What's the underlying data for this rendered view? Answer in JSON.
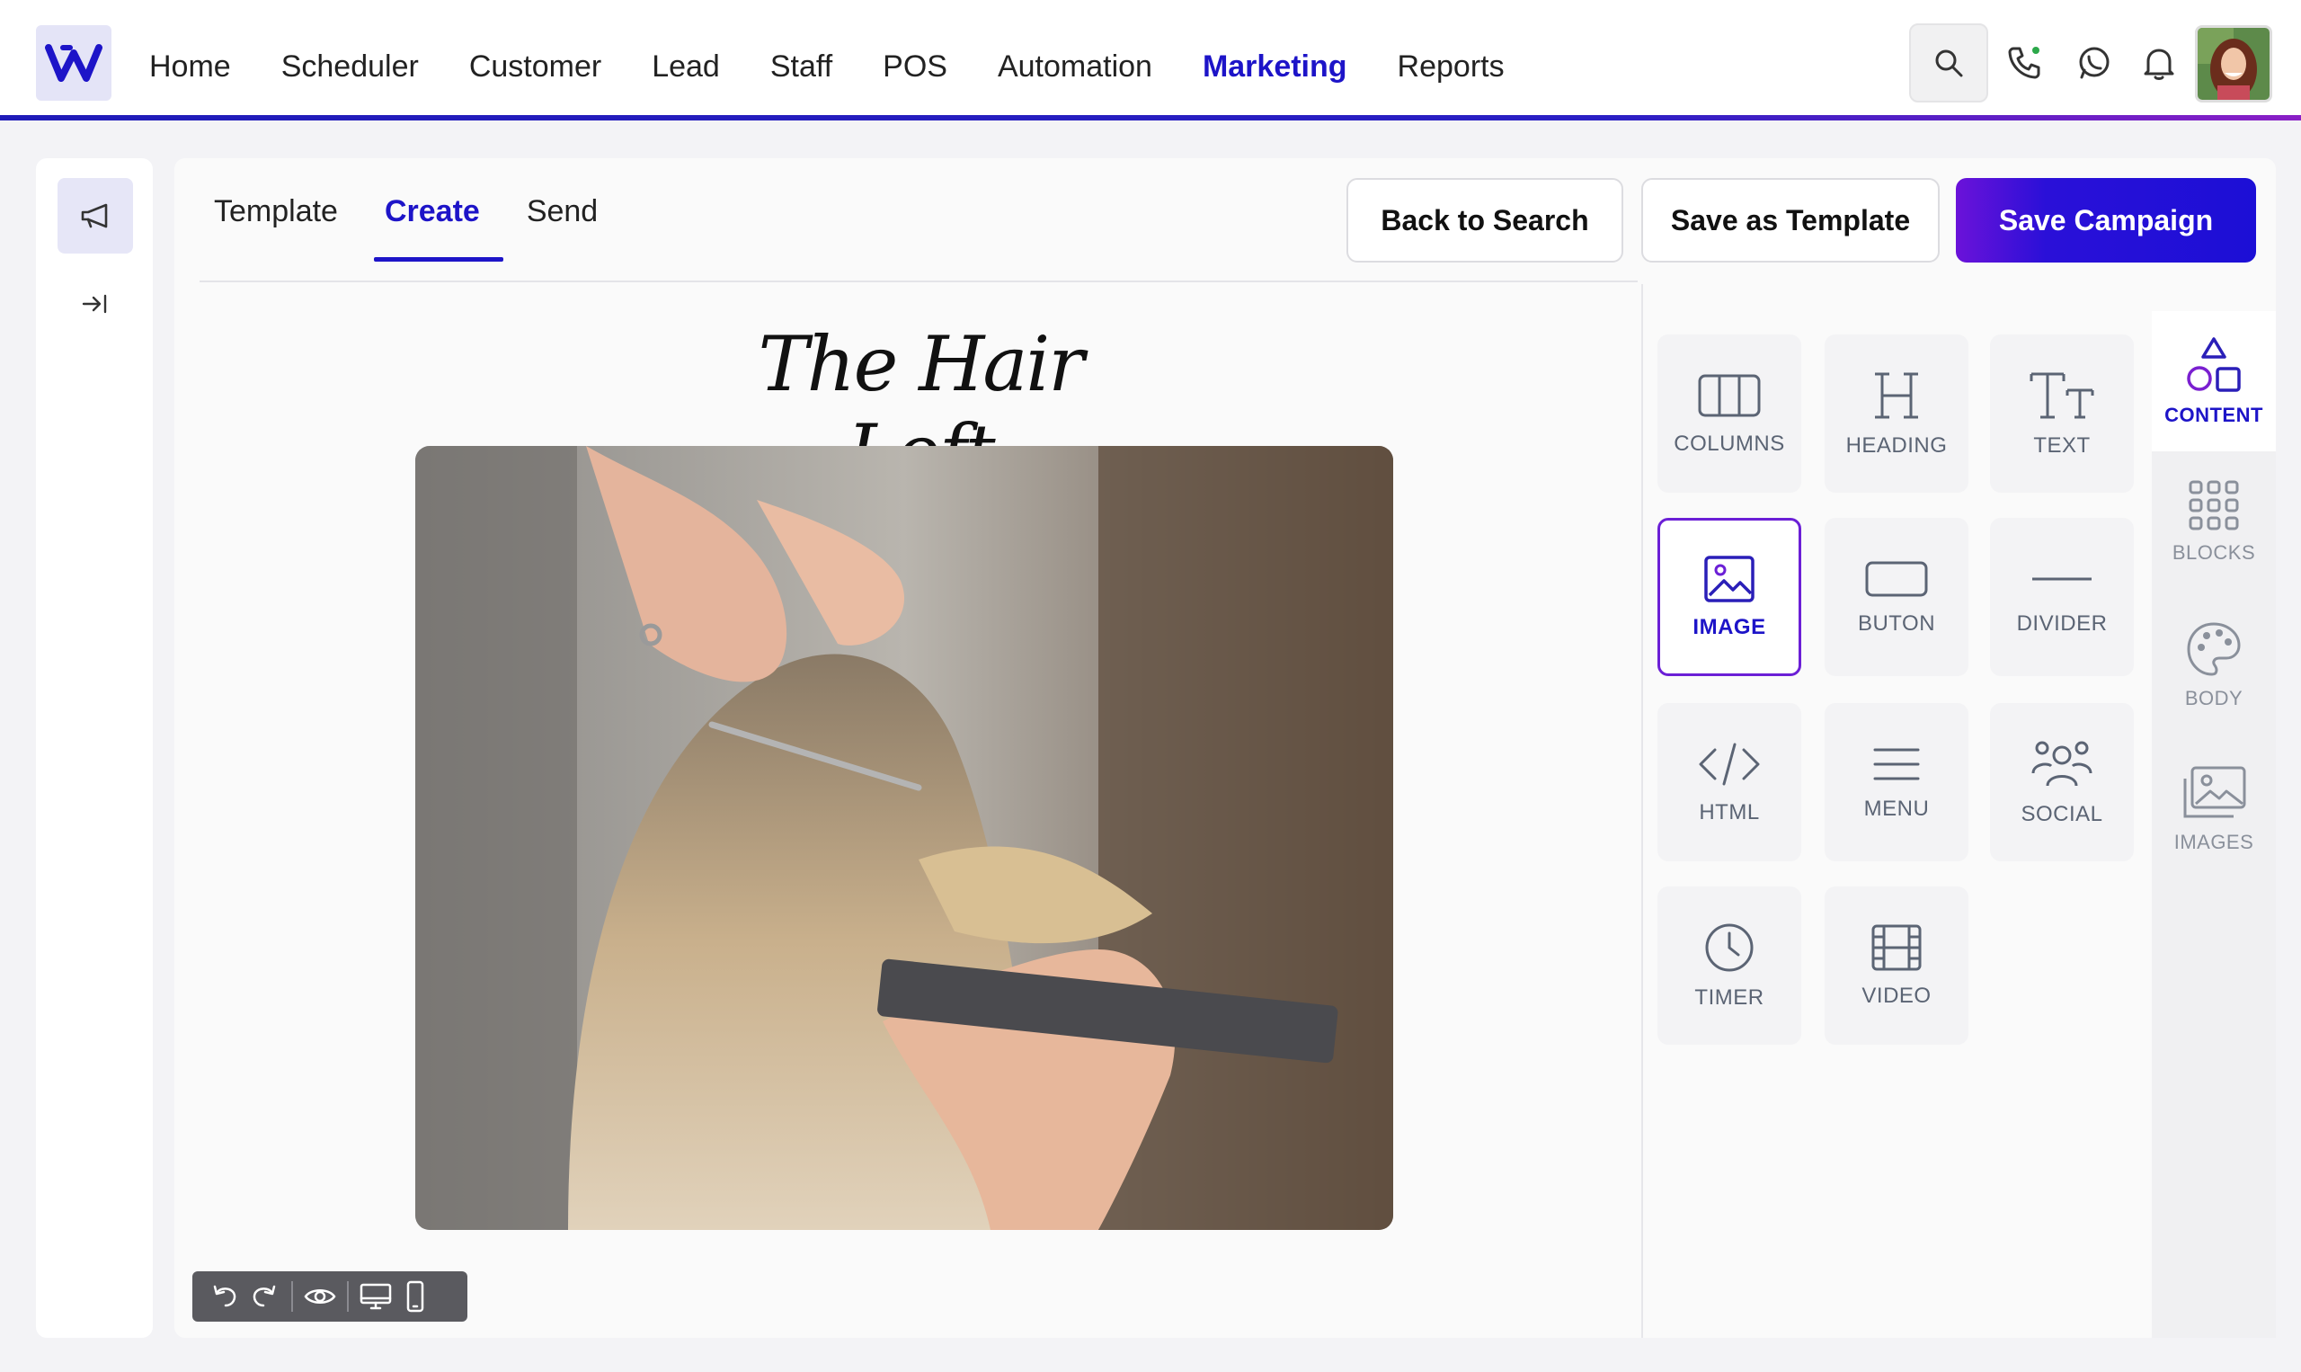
{
  "nav": {
    "items": [
      "Home",
      "Scheduler",
      "Customer",
      "Lead",
      "Staff",
      "POS",
      "Automation",
      "Marketing",
      "Reports"
    ],
    "active": "Marketing"
  },
  "tabs": [
    "Template",
    "Create",
    "Send"
  ],
  "active_tab": "Create",
  "actions": {
    "back": "Back to Search",
    "save_template": "Save as Template",
    "save_campaign": "Save Campaign"
  },
  "canvas": {
    "title": "The Hair Loft"
  },
  "content_tiles": [
    {
      "label": "COLUMNS",
      "icon": "columns-icon"
    },
    {
      "label": "HEADING",
      "icon": "heading-icon"
    },
    {
      "label": "TEXT",
      "icon": "text-icon"
    },
    {
      "label": "IMAGE",
      "icon": "image-icon",
      "active": true
    },
    {
      "label": "BUTON",
      "icon": "button-icon"
    },
    {
      "label": "DIVIDER",
      "icon": "divider-icon"
    },
    {
      "label": "HTML",
      "icon": "code-icon"
    },
    {
      "label": "MENU",
      "icon": "menu-icon"
    },
    {
      "label": "SOCIAL",
      "icon": "social-icon"
    },
    {
      "label": "TIMER",
      "icon": "clock-icon"
    },
    {
      "label": "VIDEO",
      "icon": "film-icon"
    }
  ],
  "side_tabs": [
    {
      "label": "CONTENT",
      "icon": "shapes-icon",
      "active": true
    },
    {
      "label": "BLOCKS",
      "icon": "grid-dots-icon"
    },
    {
      "label": "BODY",
      "icon": "palette-icon"
    },
    {
      "label": "IMAGES",
      "icon": "images-icon"
    }
  ],
  "colors": {
    "accent": "#1d14c8",
    "accent_purple": "#6b1fd6"
  }
}
